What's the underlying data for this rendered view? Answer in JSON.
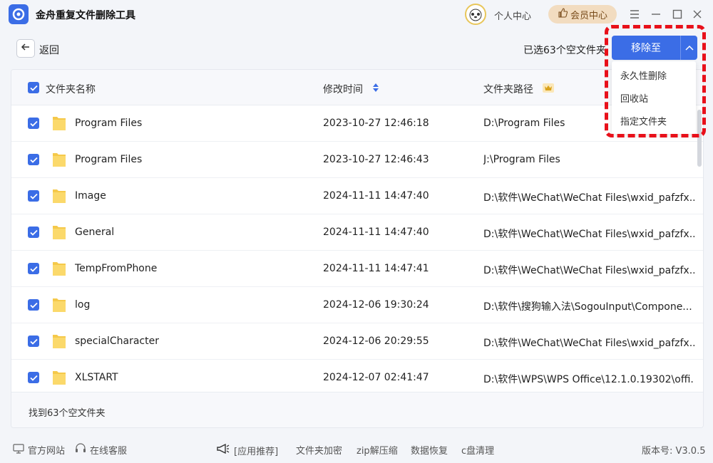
{
  "app": {
    "title": "金舟重复文件删除工具",
    "personal_center": "个人中心",
    "vip_center": "会员中心"
  },
  "toolbar": {
    "back_label": "返回",
    "selected_count": "已选63个空文件夹",
    "move_button": "移除至"
  },
  "dropdown": {
    "items": [
      "永久性删除",
      "回收站",
      "指定文件夹"
    ]
  },
  "table": {
    "headers": {
      "name": "文件夹名称",
      "modified": "修改时间",
      "path": "文件夹路径"
    },
    "rows": [
      {
        "name": "Program Files",
        "modified": "2023-10-27 12:46:18",
        "path": "D:\\Program Files"
      },
      {
        "name": "Program Files",
        "modified": "2023-10-27 12:46:43",
        "path": "J:\\Program Files"
      },
      {
        "name": "Image",
        "modified": "2024-11-11 14:47:40",
        "path": "D:\\软件\\WeChat\\WeChat Files\\wxid_pafzfx..."
      },
      {
        "name": "General",
        "modified": "2024-11-11 14:47:40",
        "path": "D:\\软件\\WeChat\\WeChat Files\\wxid_pafzfx..."
      },
      {
        "name": "TempFromPhone",
        "modified": "2024-11-11 14:47:41",
        "path": "D:\\软件\\WeChat\\WeChat Files\\wxid_pafzfx..."
      },
      {
        "name": "log",
        "modified": "2024-12-06 19:30:24",
        "path": "D:\\软件\\搜狗输入法\\SogouInput\\Compone..."
      },
      {
        "name": "specialCharacter",
        "modified": "2024-12-06 20:29:55",
        "path": "D:\\软件\\WeChat\\WeChat Files\\wxid_pafzfx..."
      },
      {
        "name": "XLSTART",
        "modified": "2024-12-07 02:41:47",
        "path": "D:\\软件\\WPS\\WPS Office\\12.1.0.19302\\offi..."
      }
    ],
    "footer": "找到63个空文件夹"
  },
  "bottom": {
    "official_site": "官方网站",
    "online_service": "在线客服",
    "recommend": "[应用推荐]",
    "links": [
      "文件夹加密",
      "zip解压缩",
      "数据恢复",
      "c盘清理"
    ],
    "version": "版本号: V3.0.5"
  },
  "colors": {
    "accent": "#3b6de6",
    "highlight": "#e8101a",
    "vip_bg": "#f2dcc0",
    "folder": "#f5c94a"
  }
}
